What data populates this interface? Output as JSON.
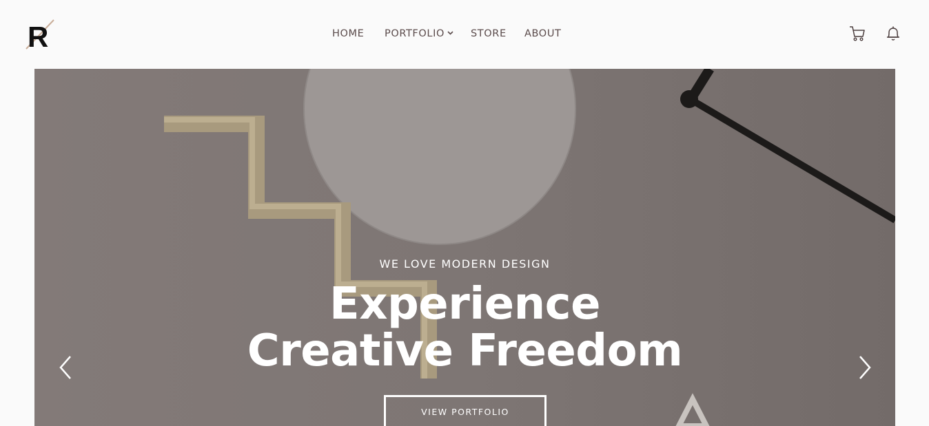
{
  "header": {
    "logo_letter": "R",
    "nav": [
      {
        "label": "HOME"
      },
      {
        "label": "PORTFOLIO"
      },
      {
        "label": "STORE"
      },
      {
        "label": "ABOUT"
      }
    ],
    "icons": [
      "chevron-down-icon",
      "cart-icon",
      "bell-icon"
    ]
  },
  "hero": {
    "subtitle": "WE LOVE MODERN DESIGN",
    "title_line1": "Experience",
    "title_line2": "Creative Freedom",
    "button_label": "VIEW PORTFOLIO",
    "icons": [
      "chevron-left-icon",
      "chevron-right-icon"
    ]
  },
  "colors": {
    "nav_text": "#5a4a4a",
    "hero_overlay_text": "#ffffff",
    "hero_background": "#7c7472"
  }
}
